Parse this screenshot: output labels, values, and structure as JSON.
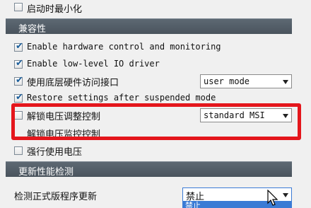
{
  "rows": {
    "start_minimized": {
      "label": "启动时最小化",
      "checked": false
    },
    "enable_hw": {
      "label": "Enable hardware control and monitoring",
      "checked": true
    },
    "enable_io": {
      "label": "Enable low-level IO driver",
      "checked": true
    },
    "use_hw_access": {
      "label": "使用底层硬件访问接口",
      "checked": true,
      "select_value": "user mode"
    },
    "restore_settings": {
      "label": "Restore settings after suspended mode",
      "checked": true
    },
    "unlock_voltage_control": {
      "label": "解锁电压调整控制",
      "checked": false,
      "select_value": "standard MSI"
    },
    "unlock_voltage_monitor": {
      "label": "解锁电压监控控制",
      "checked": false
    },
    "force_voltage": {
      "label": "强行使用电压",
      "checked": false
    }
  },
  "sections": {
    "compatibility": "兼容性",
    "update_check": "更新性能检测"
  },
  "update_check_row": {
    "label": "检测正式版程序更新",
    "select_value": "禁止",
    "dropdown_option": "禁止"
  },
  "colors": {
    "section_bg": "#515b64",
    "highlight": "#e4161c",
    "check": "#1b5e9b"
  }
}
